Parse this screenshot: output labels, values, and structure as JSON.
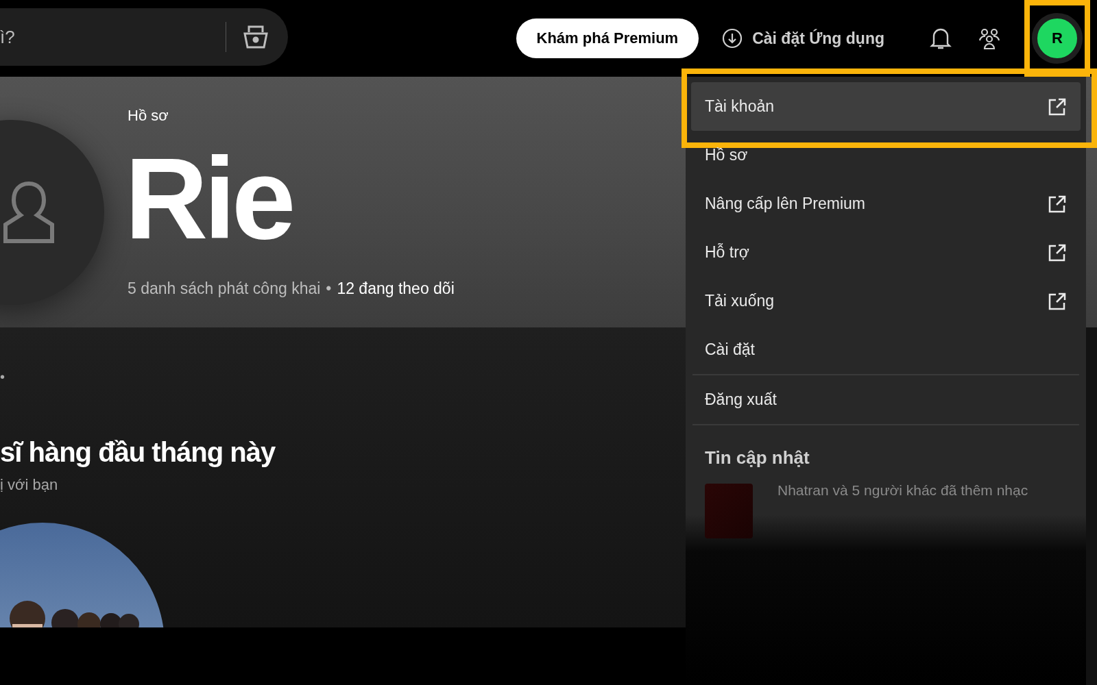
{
  "top_bar": {
    "search": {
      "value": "ì?"
    },
    "premium_button": "Khám phá Premium",
    "install_link": "Cài đặt Ứng dụng",
    "avatar": {
      "initial": "R",
      "highlighted": true
    }
  },
  "profile": {
    "label": "Hồ sơ",
    "name": "Rie",
    "stats": "5 danh sách phát công khai",
    "separator": "•",
    "following": "12 đang theo dõi"
  },
  "section": {
    "dot": "•",
    "title": "sĩ hàng đầu tháng này",
    "subtitle": "ị với bạn"
  },
  "menu": {
    "items": [
      {
        "label": "Tài khoản",
        "external": true,
        "highlighted": true,
        "divider_after": false
      },
      {
        "label": "Hồ sơ",
        "external": false,
        "highlighted": false,
        "divider_after": false
      },
      {
        "label": "Nâng cấp lên Premium",
        "external": true,
        "highlighted": false,
        "divider_after": false
      },
      {
        "label": "Hỗ trợ",
        "external": true,
        "highlighted": false,
        "divider_after": false
      },
      {
        "label": "Tải xuống",
        "external": true,
        "highlighted": false,
        "divider_after": false
      },
      {
        "label": "Cài đặt",
        "external": false,
        "highlighted": false,
        "divider_after": true
      },
      {
        "label": "Đăng xuất",
        "external": false,
        "highlighted": false,
        "divider_after": true
      }
    ],
    "updates_title": "Tin cập nhật",
    "update_text": "Nhatran và 5 người khác đã thêm nhạc"
  }
}
